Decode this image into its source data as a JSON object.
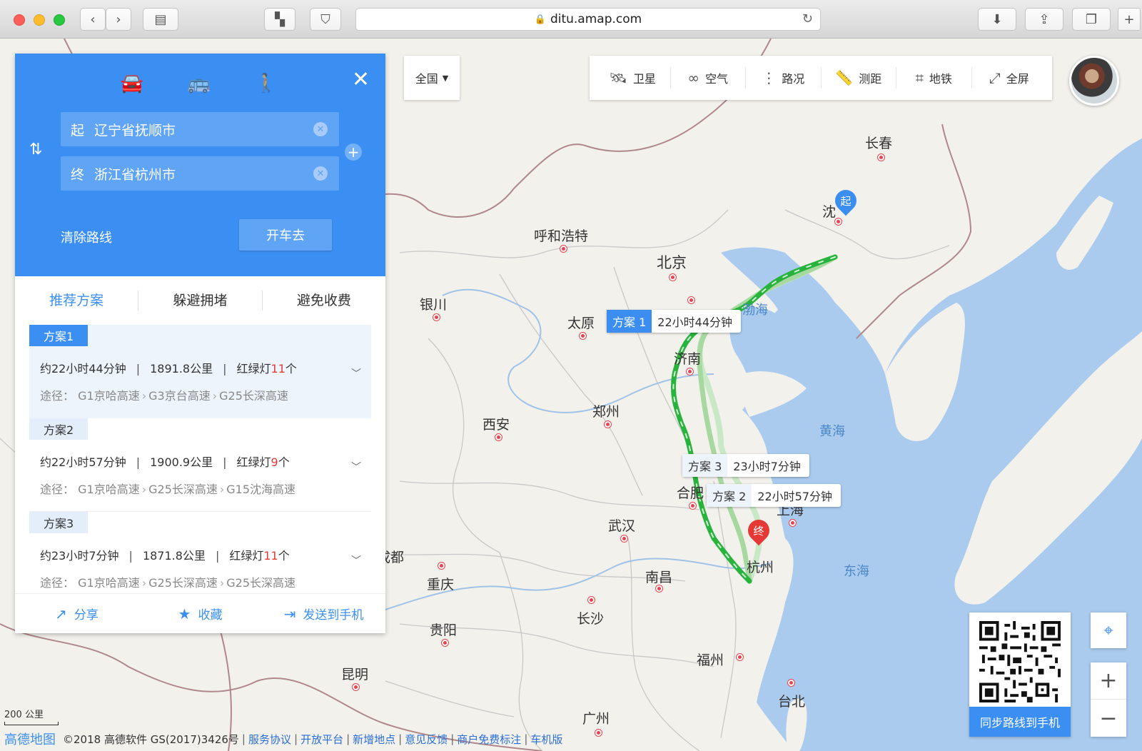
{
  "browser": {
    "url": "ditu.amap.com"
  },
  "toolbar": {
    "scope": "全国",
    "tools": [
      {
        "label": "卫星",
        "icon": "satellite-icon"
      },
      {
        "label": "空气",
        "icon": "air-icon"
      },
      {
        "label": "路况",
        "icon": "traffic-icon"
      },
      {
        "label": "测距",
        "icon": "ruler-icon"
      },
      {
        "label": "地铁",
        "icon": "subway-icon"
      },
      {
        "label": "全屏",
        "icon": "fullscreen-icon"
      }
    ]
  },
  "panel": {
    "start_prefix": "起",
    "start": "辽宁省抚顺市",
    "end_prefix": "终",
    "end": "浙江省杭州市",
    "clear_route": "清除路线",
    "go": "开车去",
    "options": [
      "推荐方案",
      "躲避拥堵",
      "避免收费"
    ],
    "routes": [
      {
        "tag": "方案1",
        "time": "约22小时44分钟",
        "distance": "1891.8公里",
        "lights_pre": "红绿灯",
        "lights": "11",
        "lights_post": "个",
        "via_label": "途径：",
        "via": [
          "G1京哈高速",
          "G3京台高速",
          "G25长深高速"
        ]
      },
      {
        "tag": "方案2",
        "time": "约22小时57分钟",
        "distance": "1900.9公里",
        "lights_pre": "红绿灯",
        "lights": "9",
        "lights_post": "个",
        "via_label": "途径：",
        "via": [
          "G1京哈高速",
          "G25长深高速",
          "G15沈海高速"
        ]
      },
      {
        "tag": "方案3",
        "time": "约23小时7分钟",
        "distance": "1871.8公里",
        "lights_pre": "红绿灯",
        "lights": "11",
        "lights_post": "个",
        "via_label": "途径：",
        "via": [
          "G1京哈高速",
          "G25长深高速",
          "G25长深高速"
        ]
      }
    ],
    "footer": [
      "分享",
      "收藏",
      "发送到手机"
    ]
  },
  "map": {
    "cities": [
      "长春",
      "沈",
      "呼和浩特",
      "北京",
      "银川",
      "太原",
      "济南",
      "郑州",
      "西安",
      "合肥",
      "上海",
      "武汉",
      "杭州",
      "成都",
      "重庆",
      "南昌",
      "长沙",
      "贵阳",
      "福州",
      "昆明",
      "台北",
      "广州"
    ],
    "seas": [
      "渤海",
      "黄海",
      "东海"
    ],
    "plan_labels": [
      {
        "tag": "方案 1",
        "time": "22小时44分钟"
      },
      {
        "tag": "方案 3",
        "time": "23小时7分钟"
      },
      {
        "tag": "方案 2",
        "time": "22小时57分钟"
      }
    ],
    "start_marker": "起",
    "end_marker": "终",
    "scale": "200 公里",
    "qr_label": "同步路线到手机"
  },
  "footer": {
    "logo": "高德地图",
    "copyright": "©2018 高德软件 GS(2017)3426号",
    "links": [
      "服务协议",
      "开放平台",
      "新增地点",
      "意见反馈",
      "商户免费标注",
      "车机版"
    ]
  }
}
